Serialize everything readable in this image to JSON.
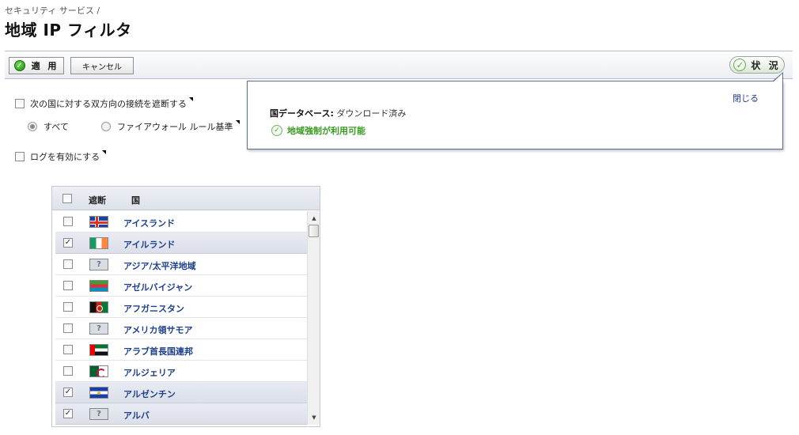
{
  "breadcrumb": "セキュリティ サービス /",
  "page_title": "地域 IP フィルタ",
  "toolbar": {
    "apply_label": "適 用",
    "cancel_label": "キャンセル",
    "status_label": "状 況"
  },
  "options": {
    "block_connections_label": "次の国に対する双方向の接続を遮断する",
    "radio_all_label": "すべて",
    "radio_firewall_label": "ファイアウォール ルール基準",
    "enable_logging_label": "ログを有効にする"
  },
  "status_popup": {
    "close_label": "閉じる",
    "db_label": "国データベース:",
    "db_value": "ダウンロード済み",
    "geo_enforcement": "地域強制が利用可能"
  },
  "table": {
    "header_block": "遮断",
    "header_country": "国",
    "rows": [
      {
        "name": "アイスランド",
        "checked": false,
        "flag": "iceland"
      },
      {
        "name": "アイルランド",
        "checked": true,
        "flag": "ireland"
      },
      {
        "name": "アジア/太平洋地域",
        "checked": false,
        "flag": "unknown"
      },
      {
        "name": "アゼルバイジャン",
        "checked": false,
        "flag": "azer"
      },
      {
        "name": "アフガニスタン",
        "checked": false,
        "flag": "afgh"
      },
      {
        "name": "アメリカ領サモア",
        "checked": false,
        "flag": "unknown"
      },
      {
        "name": "アラブ首長国連邦",
        "checked": false,
        "flag": "uae"
      },
      {
        "name": "アルジェリア",
        "checked": false,
        "flag": "alg"
      },
      {
        "name": "アルゼンチン",
        "checked": true,
        "flag": "arg"
      },
      {
        "name": "アルバ",
        "checked": true,
        "flag": "unknown"
      }
    ]
  },
  "unknown_flag_text": "?",
  "colors": {
    "link": "#1d3f8a",
    "success": "#3a9a22",
    "popup_border": "#5a6f95"
  }
}
